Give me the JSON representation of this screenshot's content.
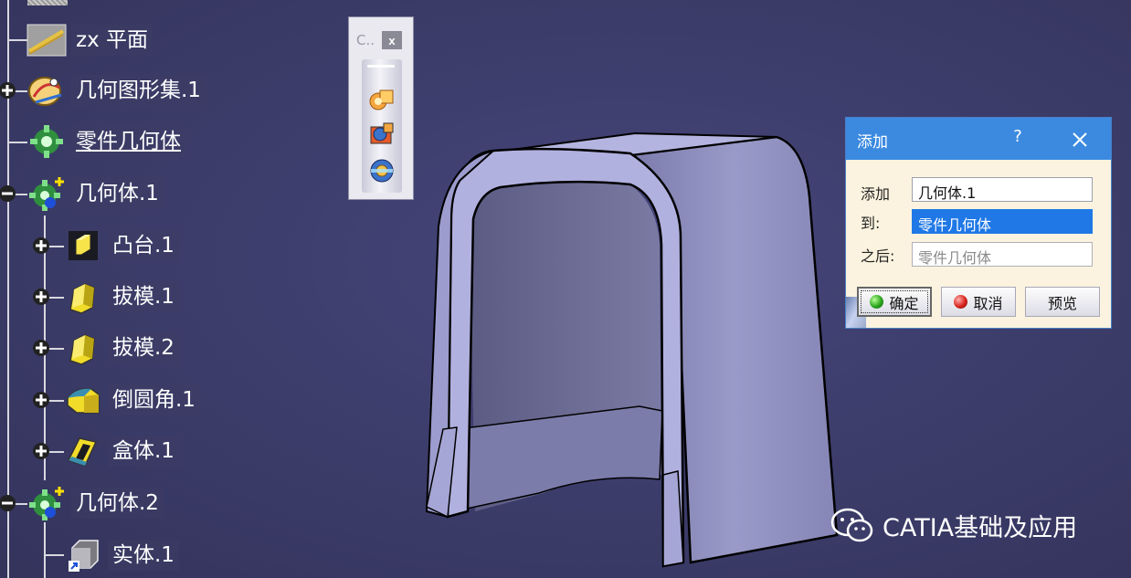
{
  "tree": {
    "items": [
      {
        "label": "zx 平面",
        "icon": "plane-icon"
      },
      {
        "label": "几何图形集.1",
        "icon": "geometrical-set-icon"
      },
      {
        "label": "零件几何体",
        "icon": "part-body-icon"
      },
      {
        "label": "几何体.1",
        "icon": "body-icon"
      },
      {
        "label": "凸台.1",
        "icon": "pad-icon"
      },
      {
        "label": "拔模.1",
        "icon": "draft-icon"
      },
      {
        "label": "拔模.2",
        "icon": "draft-icon"
      },
      {
        "label": "倒圆角.1",
        "icon": "edge-fillet-icon"
      },
      {
        "label": "盒体.1",
        "icon": "shell-icon"
      },
      {
        "label": "几何体.2",
        "icon": "body-icon"
      },
      {
        "label": "实体.1",
        "icon": "solid-icon"
      }
    ]
  },
  "toolbar": {
    "title": "C..",
    "close": "x",
    "buttons": [
      "assemble-icon",
      "add-body-icon",
      "remove-body-icon"
    ]
  },
  "dialog": {
    "title": "添加",
    "help": "?",
    "add_label": "添加",
    "add_value": "几何体.1",
    "to_label": "到:",
    "to_value": "零件几何体",
    "after_label": "之后:",
    "after_value": "零件几何体",
    "ok_label": "确定",
    "cancel_label": "取消",
    "preview_label": "预览"
  },
  "watermark": {
    "text": "CATIA基础及应用"
  },
  "colors": {
    "background": "#3d3d6a",
    "dialog_title": "#3b8ae0",
    "selection": "#1f78e6",
    "part_face": "#a9a9d8"
  }
}
